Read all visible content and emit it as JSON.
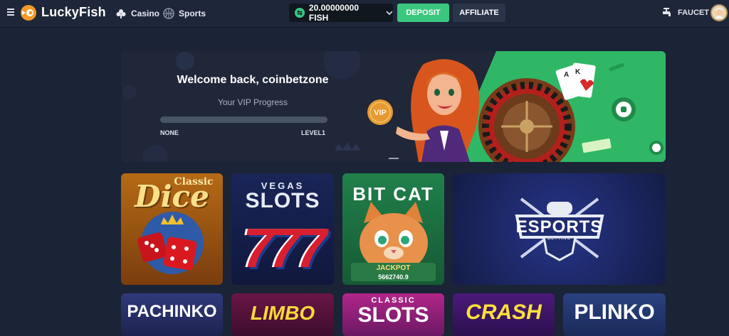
{
  "header": {
    "brand": "LuckyFish",
    "nav": [
      {
        "label": "Casino",
        "icon": "club-icon"
      },
      {
        "label": "Sports",
        "icon": "basketball-icon"
      }
    ],
    "balance": "20.00000000 FISH",
    "deposit_label": "DEPOSIT",
    "affiliate_label": "AFFILIATE",
    "faucet_label": "FAUCET"
  },
  "hero": {
    "welcome": "Welcome back, coinbetzone",
    "progress_title": "Your VIP Progress",
    "progress_fraction": 0.0,
    "level_from": "NONE",
    "level_to": "LEVEL1",
    "vip_badge": "VIP",
    "cards": [
      "A",
      "K"
    ]
  },
  "games": [
    {
      "title": "Dice",
      "subtitle": "Classic"
    },
    {
      "title": "SLOTS",
      "subtitle": "VEGAS",
      "extra": "777"
    },
    {
      "title": "BIT CAT",
      "badge": "JACKPOT",
      "jackpot": "5662740.9"
    },
    {
      "title": "ESPORTS",
      "subtitle": "BETTING"
    },
    {
      "title": "PACHINKO"
    },
    {
      "title": "LIMBO"
    },
    {
      "title": "SLOTS",
      "subtitle": "CLASSIC"
    },
    {
      "title": "CRASH"
    },
    {
      "title": "PLINKO"
    }
  ],
  "colors": {
    "background": "#1b2336",
    "accent_green": "#3bc77f",
    "brand_orange": "#f39a2b"
  }
}
